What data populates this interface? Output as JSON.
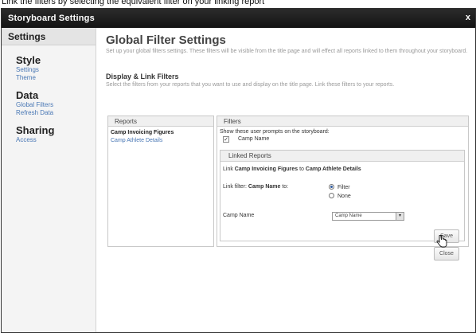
{
  "caption": "Link the filters by selecting the equivalent filter on your linking report",
  "dialog": {
    "title": "Storyboard Settings",
    "close_label": "x"
  },
  "sidebar": {
    "header": "Settings",
    "sections": [
      {
        "title": "Style",
        "links": [
          "Settings",
          "Theme"
        ]
      },
      {
        "title": "Data",
        "links": [
          "Global Filters",
          "Refresh Data"
        ]
      },
      {
        "title": "Sharing",
        "links": [
          "Access"
        ]
      }
    ]
  },
  "main": {
    "title": "Global Filter Settings",
    "description": "Set up your global filters settings. These filters will be visible from the title page and will effect all reports linked to them throughout your storyboard.",
    "subtitle": "Display & Link Filters",
    "subdescription": "Select the filters from your reports that you want to use and display on the title page. Link these filters to your reports."
  },
  "reports_panel": {
    "header": "Reports",
    "items": [
      "Camp Invoicing Figures",
      "Camp Athlete Details"
    ]
  },
  "filters_panel": {
    "header": "Filters",
    "description": "Show these user prompts on the storyboard:",
    "filter_label": "Camp Name",
    "checked": true,
    "check_mark": "✓"
  },
  "linked_reports": {
    "header": "Linked Reports",
    "link_prefix": "Link",
    "source_report": "Camp Invoicing Figures",
    "link_to": "to",
    "target_report": "Camp Athlete Details",
    "link_filter_prefix": "Link filter:",
    "link_filter_name": "Camp Name",
    "link_filter_suffix": "to:",
    "radio_options": [
      "Filter",
      "None"
    ],
    "selected_option": "Filter",
    "dropdown_label": "Camp Name",
    "dropdown_value": "Camp Name",
    "dropdown_arrow": "▾"
  },
  "buttons": {
    "save": "Save",
    "close": "Close"
  }
}
